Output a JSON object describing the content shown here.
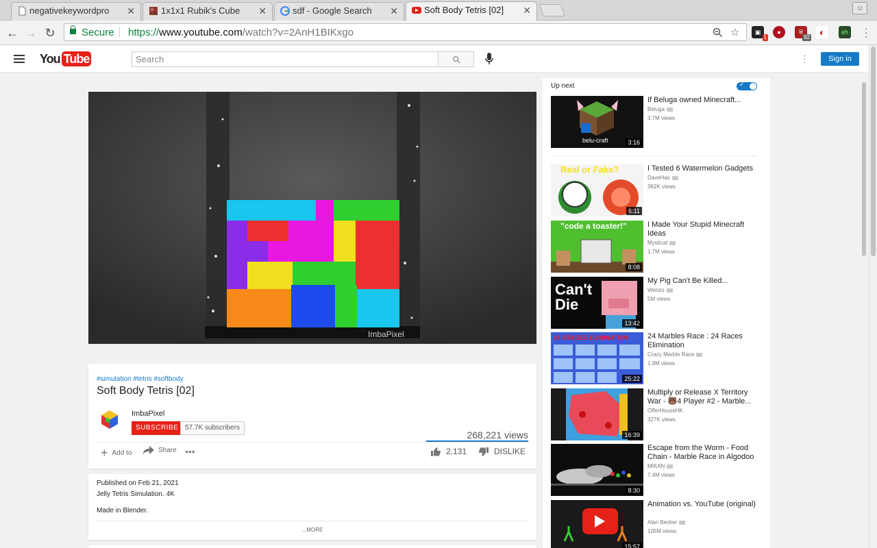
{
  "browser": {
    "tabs": [
      {
        "title": "negativekeywordpro",
        "favicon": "page-icon"
      },
      {
        "title": "1x1x1 Rubik's Cube",
        "favicon": "cube-icon"
      },
      {
        "title": "sdf - Google Search",
        "favicon": "google-icon"
      },
      {
        "title": "Soft Body Tetris [02]",
        "favicon": "youtube-icon",
        "active": true
      }
    ],
    "secure_label": "Secure",
    "url": {
      "scheme": "https://",
      "host": "www.youtube.com",
      "path": "/watch?v=2AnH1BIKxgo"
    },
    "extension_badges": [
      "1",
      "92"
    ]
  },
  "youtube": {
    "logo_you": "You",
    "logo_tube": "Tube",
    "search_placeholder": "Search",
    "signin_label": "Sign in",
    "brand_red": "#e62117",
    "link_blue": "#167ac6"
  },
  "video": {
    "hashtags": "#simulation #tetris #softbody",
    "title": "Soft Body Tetris [02]",
    "watermark": "ImbaPixel",
    "channel": "ImbaPixel",
    "subscribe_label": "SUBSCRIBE",
    "subscribers": "57.7K subscribers",
    "views": "268,221 views",
    "add_to_label": "Add to",
    "share_label": "Share",
    "likes": "2,131",
    "dislike_label": "DISLIKE",
    "like_ratio": 1.0
  },
  "description": {
    "published": "Published on Feb 21, 2021",
    "line1": "Jelly Tetris Simulation. 4K",
    "line2": "Made in Blender.",
    "more_label": "...MORE"
  },
  "sidebar": {
    "up_next_label": "Up next",
    "autoplay_on": true,
    "videos": [
      {
        "title": "If Beluga owned Minecraft...",
        "channel": "Beluga",
        "views": "3.7M views",
        "duration": "3:16",
        "thumb_text": "belu-craft"
      },
      {
        "title": "I Tested 6 Watermelon Gadgets",
        "channel": "DaveHax",
        "views": "362K views",
        "duration": "6:11",
        "thumb_text": "Real or Fake?"
      },
      {
        "title": "I Made Your Stupid Minecraft Ideas",
        "channel": "Mysticat",
        "views": "1.7M views",
        "duration": "8:08",
        "thumb_text": "\"code a toaster!\""
      },
      {
        "title": "My Pig Can't Be Killed...",
        "channel": "Wenzo",
        "views": "5M views",
        "duration": "13:42",
        "thumb_text": "Can't Die"
      },
      {
        "title": "24 Marbles Race : 24 Races Elimination",
        "channel": "Crazy Marble Race",
        "views": "1.9M views",
        "duration": "25:22",
        "thumb_text": "24 STAGES ELIMINATION"
      },
      {
        "title": "Multiply or Release X Territory War - 🐻4 Player #2 - Marble...",
        "channel": "OfferHouseHK",
        "views": "327K views",
        "duration": "16:39",
        "thumb_text": ""
      },
      {
        "title": "Escape from the Worm - Food Chain - Marble Race in Algodoo",
        "channel": "MIKAN",
        "views": "7.4M views",
        "duration": "8:30",
        "thumb_text": ""
      },
      {
        "title": "Animation vs. YouTube (original)",
        "channel": "Alan Becker",
        "views": "105M views",
        "duration": "15:57",
        "thumb_text": ""
      }
    ]
  }
}
